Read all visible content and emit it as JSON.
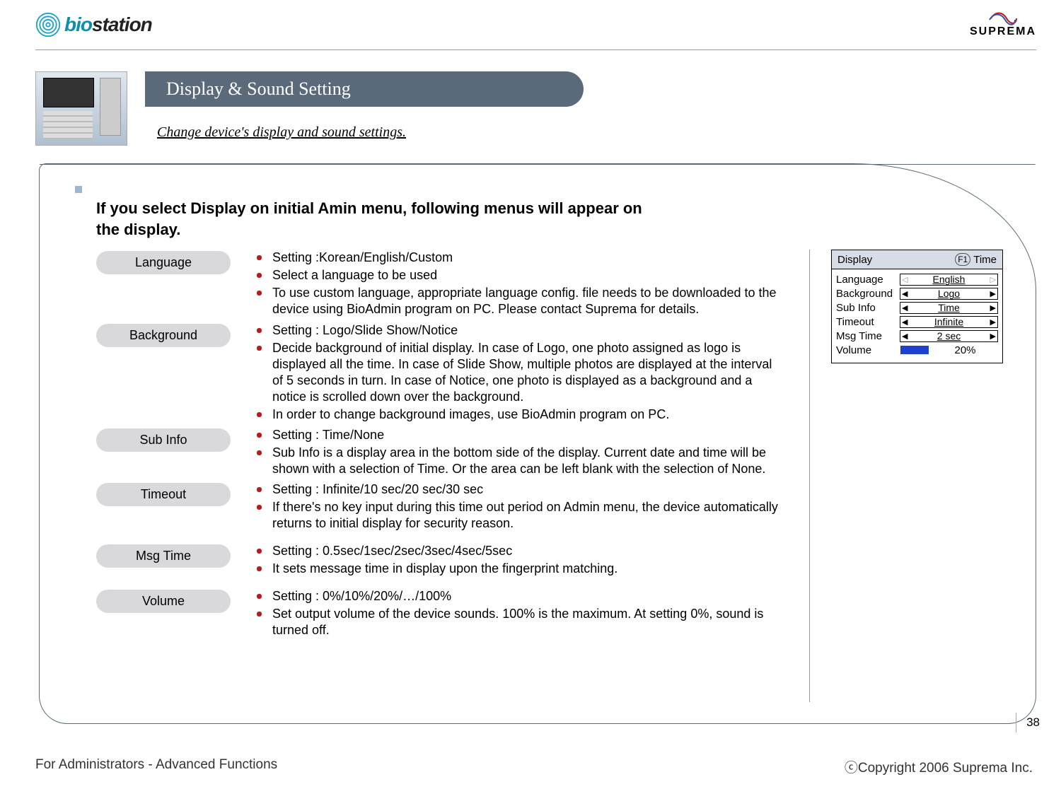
{
  "header": {
    "logo_left": "biostation",
    "logo_right": "SUPREMA"
  },
  "title_bar": "Display & Sound Setting",
  "subtitle": "Change device's display and sound settings.",
  "intro": "If you select Display on initial Amin menu, following menus will appear on the display.",
  "settings": [
    {
      "label": "Language",
      "bullets": [
        "Setting :Korean/English/Custom",
        "Select a language to be used",
        "To use custom language, appropriate language config. file needs to be downloaded to the device using BioAdmin program on PC. Please contact Suprema for details."
      ]
    },
    {
      "label": "Background",
      "bullets": [
        "Setting : Logo/Slide Show/Notice",
        "Decide background of initial display. In case of Logo, one photo assigned as logo is displayed all the time. In case of Slide Show, multiple photos are displayed at the interval of 5 seconds in turn. In case of Notice, one photo is displayed as a background and a notice is scrolled down over the background.",
        "In order to change background images, use BioAdmin program on PC."
      ]
    },
    {
      "label": "Sub Info",
      "bullets": [
        "Setting : Time/None",
        "Sub Info is a display area in the bottom side of the display. Current date and time will be shown with a selection of Time. Or the area can be left blank with the selection of None."
      ]
    },
    {
      "label": "Timeout",
      "bullets": [
        "Setting : Infinite/10 sec/20 sec/30 sec",
        "If there's no key input during this time out period on Admin menu, the device automatically returns to initial display for security reason."
      ]
    },
    {
      "label": "Msg Time",
      "bullets": [
        "Setting : 0.5sec/1sec/2sec/3sec/4sec/5sec",
        "It sets message time in display upon the fingerprint matching."
      ]
    },
    {
      "label": "Volume",
      "bullets": [
        "Setting : 0%/10%/20%/…/100%",
        "Set output volume of the device sounds. 100% is the maximum. At setting 0%, sound is turned off."
      ]
    }
  ],
  "device_screen": {
    "title": "Display",
    "f1": "F1",
    "f1_label": "Time",
    "rows": [
      {
        "label": "Language",
        "value": "English",
        "light": true
      },
      {
        "label": "Background",
        "value": "Logo",
        "light": false
      },
      {
        "label": "Sub Info",
        "value": "Time",
        "light": false
      },
      {
        "label": "Timeout",
        "value": "Infinite",
        "light": false
      },
      {
        "label": "Msg Time",
        "value": "2 sec",
        "light": false
      }
    ],
    "volume_label": "Volume",
    "volume_value": "20%"
  },
  "page_number": "38",
  "footer": {
    "left": "For Administrators - Advanced Functions",
    "right": "ⓒCopyright 2006 Suprema Inc."
  }
}
